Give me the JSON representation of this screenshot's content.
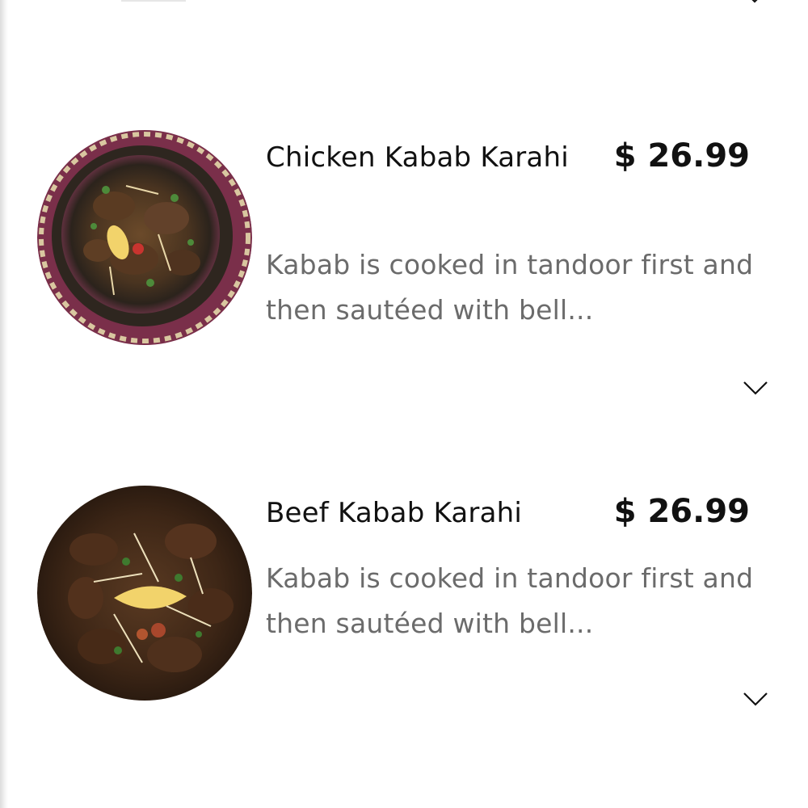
{
  "menu": {
    "items": [
      {
        "name": "Chicken Kabab Karahi",
        "price": "$ 26.99",
        "description": "Kabab is cooked in tandoor first and then sautéed with bell...",
        "image_icon": "chicken-kabab-karahi-photo"
      },
      {
        "name": "Beef Kabab Karahi",
        "price": "$ 26.99",
        "description": "Kabab is cooked in tandoor first and then sautéed with bell...",
        "image_icon": "beef-kabab-karahi-photo"
      }
    ],
    "expand_icon": "chevron-down-icon"
  },
  "colors": {
    "title": "#111111",
    "price": "#111111",
    "description": "#6b6b6b",
    "background": "#ffffff"
  }
}
